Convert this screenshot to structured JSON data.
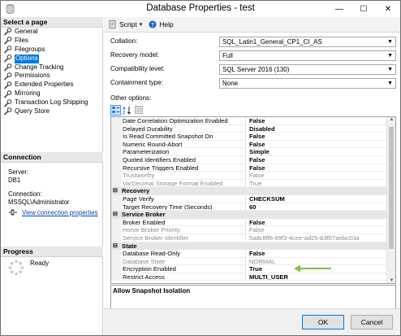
{
  "window": {
    "title": "Database Properties - test",
    "minimize": "—",
    "maximize": "☐",
    "close": "✕"
  },
  "left": {
    "select_page_header": "Select a page",
    "pages": [
      {
        "label": "General"
      },
      {
        "label": "Files"
      },
      {
        "label": "Filegroups"
      },
      {
        "label": "Options"
      },
      {
        "label": "Change Tracking"
      },
      {
        "label": "Permissions"
      },
      {
        "label": "Extended Properties"
      },
      {
        "label": "Mirroring"
      },
      {
        "label": "Transaction Log Shipping"
      },
      {
        "label": "Query Store"
      }
    ],
    "selected_page": "Options",
    "connection_header": "Connection",
    "server_label": "Server:",
    "server_value": "DB1",
    "connection_label": "Connection:",
    "connection_value": "MSSQL\\Administrator",
    "view_connection_link": "View connection properties",
    "progress_header": "Progress",
    "progress_status": "Ready"
  },
  "toolbar": {
    "script_label": "Script",
    "help_label": "Help"
  },
  "form": {
    "collation_label": "Collation:",
    "collation_value": "SQL_Latin1_General_CP1_CI_AS",
    "recovery_label": "Recovery model:",
    "recovery_value": "Full",
    "compat_label": "Compatibility level:",
    "compat_value": "SQL Server 2016 (130)",
    "containment_label": "Containment type:",
    "containment_value": "None",
    "other_options_label": "Other options:"
  },
  "grid": {
    "rows": [
      {
        "name": "Date Correlation Optimization Enabled",
        "value": "False"
      },
      {
        "name": "Delayed Durability",
        "value": "Disabled"
      },
      {
        "name": "Is Read Committed Snapshot On",
        "value": "False"
      },
      {
        "name": "Numeric Round-Abort",
        "value": "False"
      },
      {
        "name": "Parameterization",
        "value": "Simple"
      },
      {
        "name": "Quoted Identifiers Enabled",
        "value": "False"
      },
      {
        "name": "Recursive Triggers Enabled",
        "value": "False"
      },
      {
        "name": "Trustworthy",
        "value": "False"
      },
      {
        "name": "VarDecimal Storage Format Enabled",
        "value": "True"
      },
      {
        "category": "Recovery"
      },
      {
        "name": "Page Verify",
        "value": "CHECKSUM"
      },
      {
        "name": "Target Recovery Time (Seconds)",
        "value": "60"
      },
      {
        "category": "Service Broker"
      },
      {
        "name": "Broker Enabled",
        "value": "False"
      },
      {
        "name": "Honor Broker Priority",
        "value": "False"
      },
      {
        "name": "Service Broker Identifier",
        "value": "5adc8ff6-89f3-4cee-ad25-b3f07aebc03a"
      },
      {
        "category": "State"
      },
      {
        "name": "Database Read-Only",
        "value": "False"
      },
      {
        "name": "Database State",
        "value": "NORMAL"
      },
      {
        "name": "Encryption Enabled",
        "value": "True"
      },
      {
        "name": "Restrict Access",
        "value": "MULTI_USER"
      }
    ],
    "description_title": "Allow Snapshot Isolation"
  },
  "buttons": {
    "ok": "OK",
    "cancel": "Cancel"
  },
  "colors": {
    "selection": "#0078d7",
    "annotation_arrow": "#7dc242",
    "link": "#0645ad"
  }
}
